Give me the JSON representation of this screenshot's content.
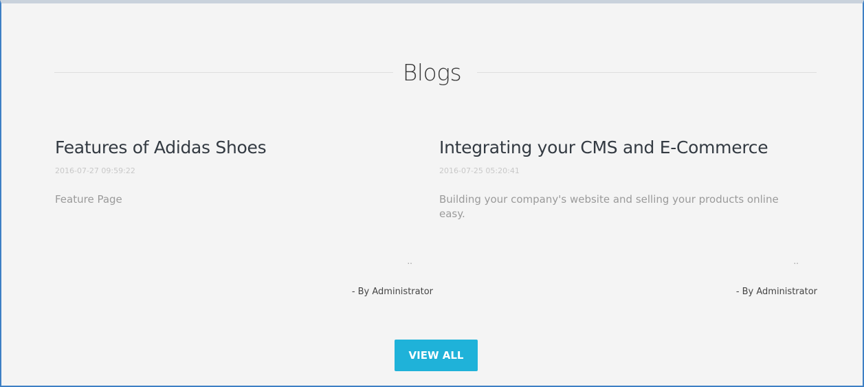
{
  "section": {
    "title": "Blogs"
  },
  "blogs": [
    {
      "title": "Features of Adidas Shoes",
      "date": "2016-07-27 09:59:22",
      "excerpt": "Feature Page",
      "more": "..",
      "author": "- By Administrator"
    },
    {
      "title": "Integrating your CMS and E-Commerce",
      "date": "2016-07-25 05:20:41",
      "excerpt": "Building your company's website and selling your products online easy.",
      "more": "..",
      "author": "- By Administrator"
    }
  ],
  "actions": {
    "view_all_label": "VIEW ALL"
  },
  "colors": {
    "accent": "#1fb2d9",
    "background": "#f4f4f4",
    "frame_border": "#3d7fc4"
  }
}
